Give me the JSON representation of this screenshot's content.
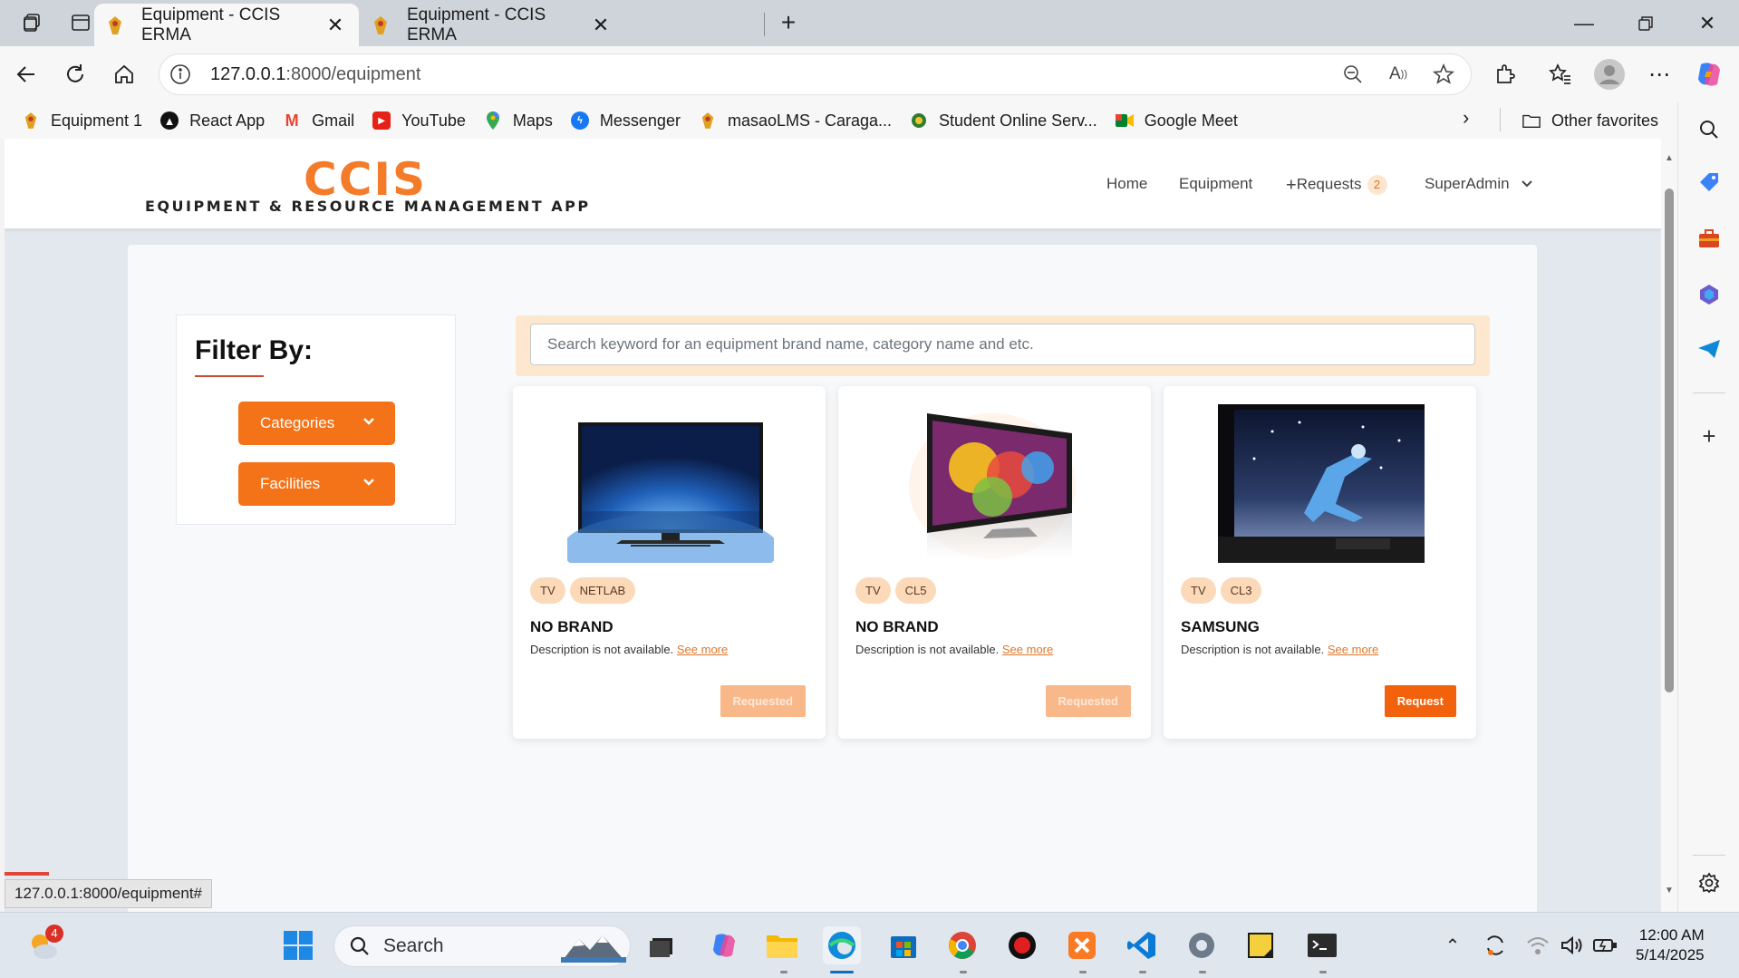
{
  "browser": {
    "tabs": [
      {
        "title": "Equipment - CCIS ERMA",
        "active": true
      },
      {
        "title": "Equipment - CCIS ERMA",
        "active": false
      }
    ],
    "url_host": "127.0.0.1",
    "url_path": ":8000/equipment",
    "bookmarks": [
      {
        "label": "Equipment 1",
        "icon": "ccis-logo-icon"
      },
      {
        "label": "React App",
        "icon": "react-icon"
      },
      {
        "label": "Gmail",
        "icon": "gmail-icon"
      },
      {
        "label": "YouTube",
        "icon": "youtube-icon"
      },
      {
        "label": "Maps",
        "icon": "maps-icon"
      },
      {
        "label": "Messenger",
        "icon": "messenger-icon"
      },
      {
        "label": "masaoLMS - Caraga...",
        "icon": "lms-icon"
      },
      {
        "label": "Student Online Serv...",
        "icon": "school-seal-icon"
      },
      {
        "label": "Google Meet",
        "icon": "meet-icon"
      }
    ],
    "other_favorites": "Other favorites",
    "status_url": "127.0.0.1:8000/equipment#"
  },
  "app": {
    "logo_main": "CCIS",
    "logo_sub": "EQUIPMENT & RESOURCE MANAGEMENT APP",
    "nav": {
      "home": "Home",
      "equipment": "Equipment",
      "requests": "Requests",
      "requests_count": "2",
      "user": "SuperAdmin"
    },
    "filter": {
      "title": "Filter By:",
      "categories": "Categories",
      "facilities": "Facilities"
    },
    "search_placeholder": "Search keyword for an equipment brand name, category name and etc.",
    "items": [
      {
        "tags": [
          "TV",
          "NETLAB"
        ],
        "brand": "NO BRAND",
        "desc": "Description is not available.",
        "see_more": "See more",
        "button": "Requested",
        "button_state": "disabled"
      },
      {
        "tags": [
          "TV",
          "CL5"
        ],
        "brand": "NO BRAND",
        "desc": "Description is not available.",
        "see_more": "See more",
        "button": "Requested",
        "button_state": "disabled"
      },
      {
        "tags": [
          "TV",
          "CL3"
        ],
        "brand": "SAMSUNG",
        "desc": "Description is not available.",
        "see_more": "See more",
        "button": "Request",
        "button_state": "enabled"
      }
    ]
  },
  "taskbar": {
    "search_label": "Search",
    "weather_badge": "4",
    "time": "12:00 AM",
    "date": "5/14/2025"
  },
  "colors": {
    "accent": "#f57318",
    "tag_bg": "#fcd9b9",
    "search_frame": "#fde7cf"
  }
}
